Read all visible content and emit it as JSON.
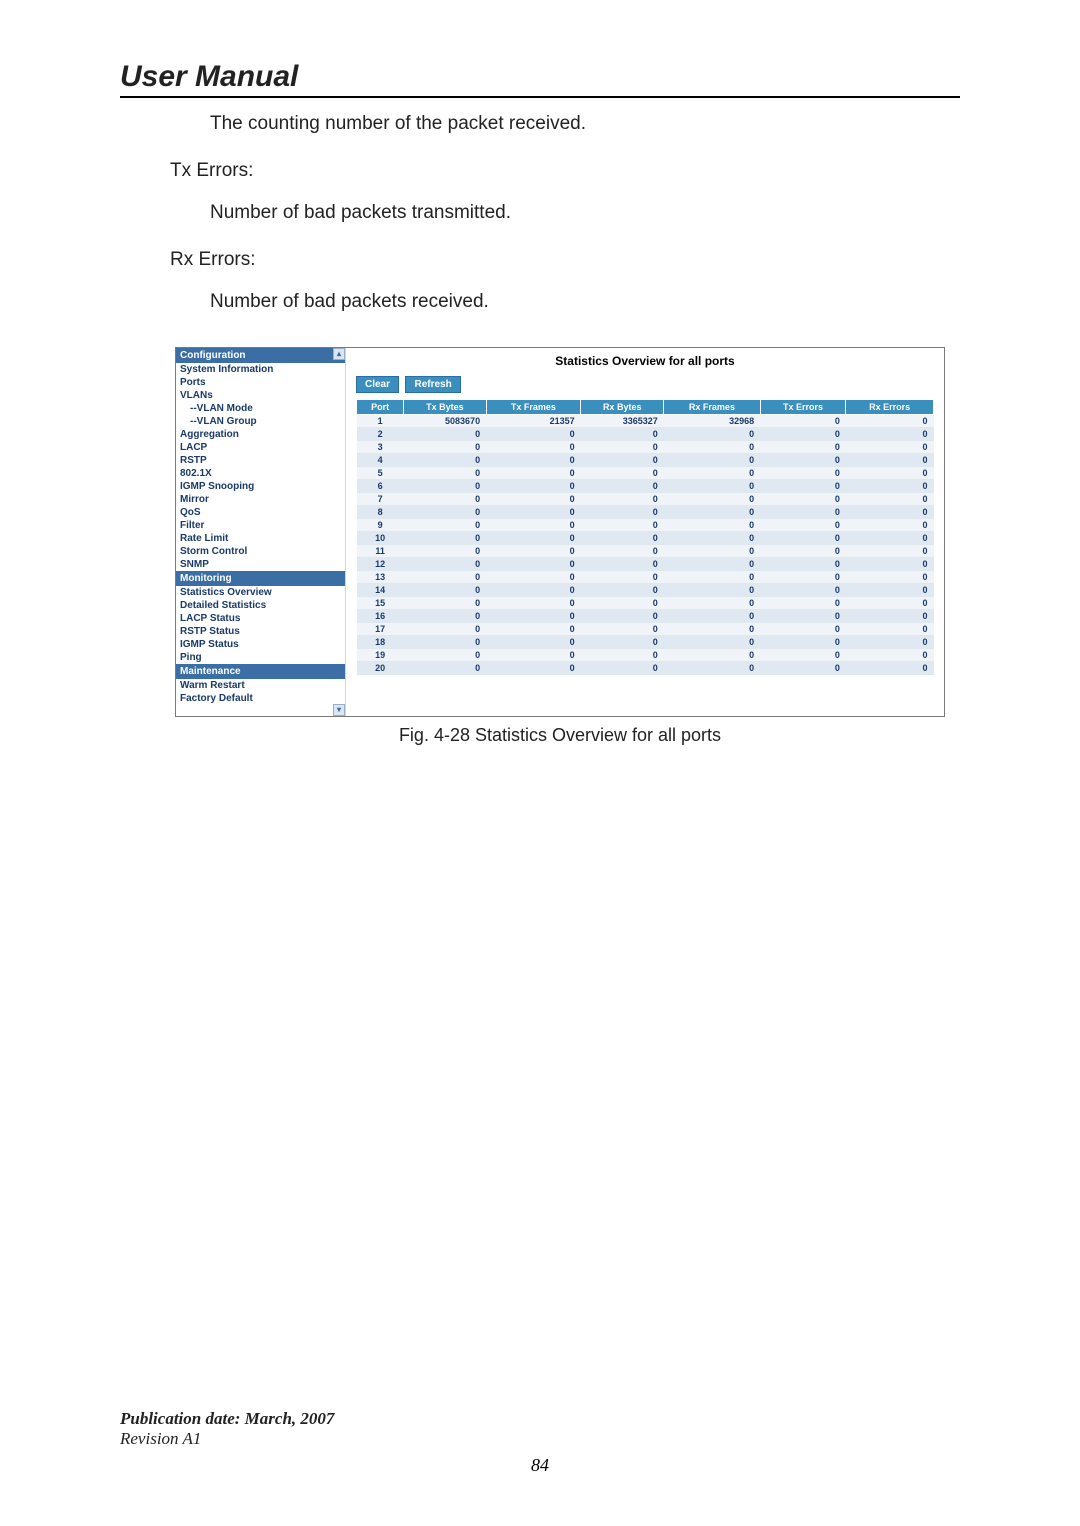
{
  "title": "User Manual",
  "body": {
    "rx_frames_desc": "The counting number of the packet received.",
    "tx_errors_label": "Tx Errors:",
    "tx_errors_desc": "Number of bad packets transmitted.",
    "rx_errors_label": "Rx Errors:",
    "rx_errors_desc": "Number of bad packets received."
  },
  "fig": {
    "sidebar": {
      "config_hdr": "Configuration",
      "items_config": [
        "System Information",
        "Ports",
        "VLANs",
        "--VLAN Mode",
        "--VLAN Group",
        "Aggregation",
        "LACP",
        "RSTP",
        "802.1X",
        "IGMP Snooping",
        "Mirror",
        "QoS",
        "Filter",
        "Rate Limit",
        "Storm Control",
        "SNMP"
      ],
      "monitoring_hdr": "Monitoring",
      "items_monitoring": [
        "Statistics Overview",
        "Detailed Statistics",
        "LACP Status",
        "RSTP Status",
        "IGMP Status",
        "Ping"
      ],
      "maintenance_hdr": "Maintenance",
      "items_maintenance": [
        "Warm Restart",
        "Factory Default"
      ]
    },
    "stats_title": "Statistics Overview for all ports",
    "buttons": {
      "clear": "Clear",
      "refresh": "Refresh"
    },
    "columns": [
      "Port",
      "Tx Bytes",
      "Tx Frames",
      "Rx Bytes",
      "Rx Frames",
      "Tx Errors",
      "Rx Errors"
    ],
    "rows": [
      {
        "port": "1",
        "txb": "5083670",
        "txf": "21357",
        "rxb": "3365327",
        "rxf": "32968",
        "txe": "0",
        "rxe": "0"
      },
      {
        "port": "2",
        "txb": "0",
        "txf": "0",
        "rxb": "0",
        "rxf": "0",
        "txe": "0",
        "rxe": "0"
      },
      {
        "port": "3",
        "txb": "0",
        "txf": "0",
        "rxb": "0",
        "rxf": "0",
        "txe": "0",
        "rxe": "0"
      },
      {
        "port": "4",
        "txb": "0",
        "txf": "0",
        "rxb": "0",
        "rxf": "0",
        "txe": "0",
        "rxe": "0"
      },
      {
        "port": "5",
        "txb": "0",
        "txf": "0",
        "rxb": "0",
        "rxf": "0",
        "txe": "0",
        "rxe": "0"
      },
      {
        "port": "6",
        "txb": "0",
        "txf": "0",
        "rxb": "0",
        "rxf": "0",
        "txe": "0",
        "rxe": "0"
      },
      {
        "port": "7",
        "txb": "0",
        "txf": "0",
        "rxb": "0",
        "rxf": "0",
        "txe": "0",
        "rxe": "0"
      },
      {
        "port": "8",
        "txb": "0",
        "txf": "0",
        "rxb": "0",
        "rxf": "0",
        "txe": "0",
        "rxe": "0"
      },
      {
        "port": "9",
        "txb": "0",
        "txf": "0",
        "rxb": "0",
        "rxf": "0",
        "txe": "0",
        "rxe": "0"
      },
      {
        "port": "10",
        "txb": "0",
        "txf": "0",
        "rxb": "0",
        "rxf": "0",
        "txe": "0",
        "rxe": "0"
      },
      {
        "port": "11",
        "txb": "0",
        "txf": "0",
        "rxb": "0",
        "rxf": "0",
        "txe": "0",
        "rxe": "0"
      },
      {
        "port": "12",
        "txb": "0",
        "txf": "0",
        "rxb": "0",
        "rxf": "0",
        "txe": "0",
        "rxe": "0"
      },
      {
        "port": "13",
        "txb": "0",
        "txf": "0",
        "rxb": "0",
        "rxf": "0",
        "txe": "0",
        "rxe": "0"
      },
      {
        "port": "14",
        "txb": "0",
        "txf": "0",
        "rxb": "0",
        "rxf": "0",
        "txe": "0",
        "rxe": "0"
      },
      {
        "port": "15",
        "txb": "0",
        "txf": "0",
        "rxb": "0",
        "rxf": "0",
        "txe": "0",
        "rxe": "0"
      },
      {
        "port": "16",
        "txb": "0",
        "txf": "0",
        "rxb": "0",
        "rxf": "0",
        "txe": "0",
        "rxe": "0"
      },
      {
        "port": "17",
        "txb": "0",
        "txf": "0",
        "rxb": "0",
        "rxf": "0",
        "txe": "0",
        "rxe": "0"
      },
      {
        "port": "18",
        "txb": "0",
        "txf": "0",
        "rxb": "0",
        "rxf": "0",
        "txe": "0",
        "rxe": "0"
      },
      {
        "port": "19",
        "txb": "0",
        "txf": "0",
        "rxb": "0",
        "rxf": "0",
        "txe": "0",
        "rxe": "0"
      },
      {
        "port": "20",
        "txb": "0",
        "txf": "0",
        "rxb": "0",
        "rxf": "0",
        "txe": "0",
        "rxe": "0"
      }
    ]
  },
  "caption": "Fig. 4-28 Statistics Overview for all ports",
  "footer": {
    "pub": "Publication date: March, 2007",
    "rev": "Revision A1",
    "page": "84"
  }
}
